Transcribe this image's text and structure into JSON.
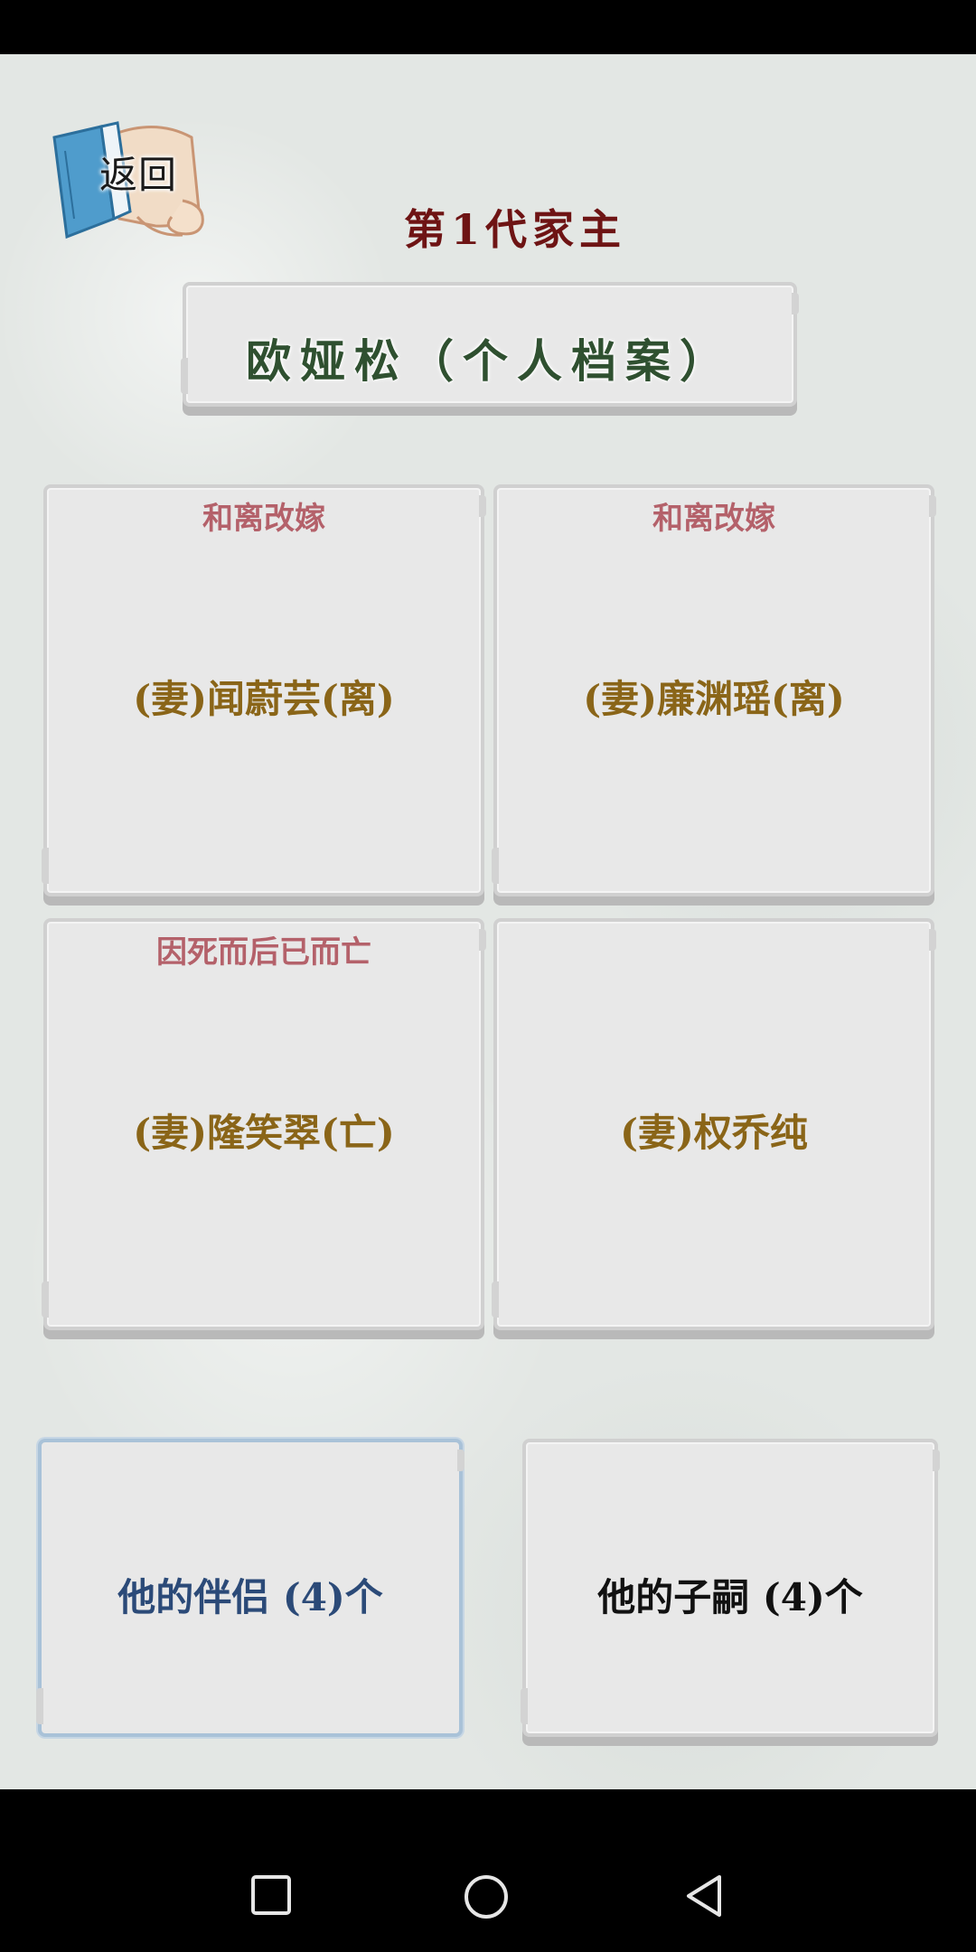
{
  "back_button": {
    "label": "返回",
    "icon": "scroll-book-icon"
  },
  "title": "第1代家主",
  "profile": {
    "name": "欧娅松（个人档案）"
  },
  "spouses": [
    {
      "status": "和离改嫁",
      "name": "(妻)闻蔚芸(离)"
    },
    {
      "status": "和离改嫁",
      "name": "(妻)廉渊瑶(离)"
    },
    {
      "status": "因死而后已而亡",
      "name": "(妻)隆笑翠(亡)"
    },
    {
      "status": "",
      "name": "(妻)权乔纯"
    }
  ],
  "tabs": {
    "partners": "他的伴侣 (4)个",
    "children": "他的子嗣 (4)个",
    "active": "partners"
  },
  "system_nav": {
    "recents_icon": "square-icon",
    "home_icon": "circle-icon",
    "back_icon": "triangle-back-icon"
  },
  "colors": {
    "title": "#6e1414",
    "profile_name": "#2f5030",
    "status": "#b4616a",
    "spouse_name": "#8a6518",
    "active_tab": "#2b4a78"
  }
}
